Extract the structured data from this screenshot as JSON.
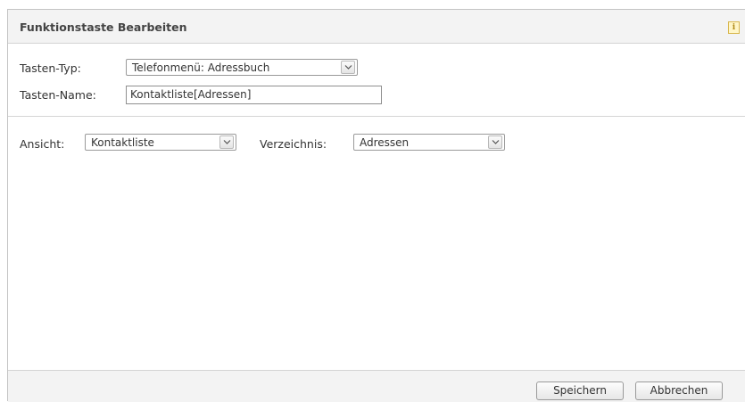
{
  "dialog": {
    "title": "Funktionstaste Bearbeiten",
    "info_icon": "info-icon"
  },
  "form": {
    "key_type_label": "Tasten-Typ:",
    "key_type_value": "Telefonmenü: Adressbuch",
    "key_name_label": "Tasten-Name:",
    "key_name_value": "Kontaktliste[Adressen]"
  },
  "view": {
    "ansicht_label": "Ansicht:",
    "ansicht_value": "Kontaktliste",
    "verzeichnis_label": "Verzeichnis:",
    "verzeichnis_value": "Adressen"
  },
  "footer": {
    "save_label": "Speichern",
    "cancel_label": "Abbrechen"
  }
}
